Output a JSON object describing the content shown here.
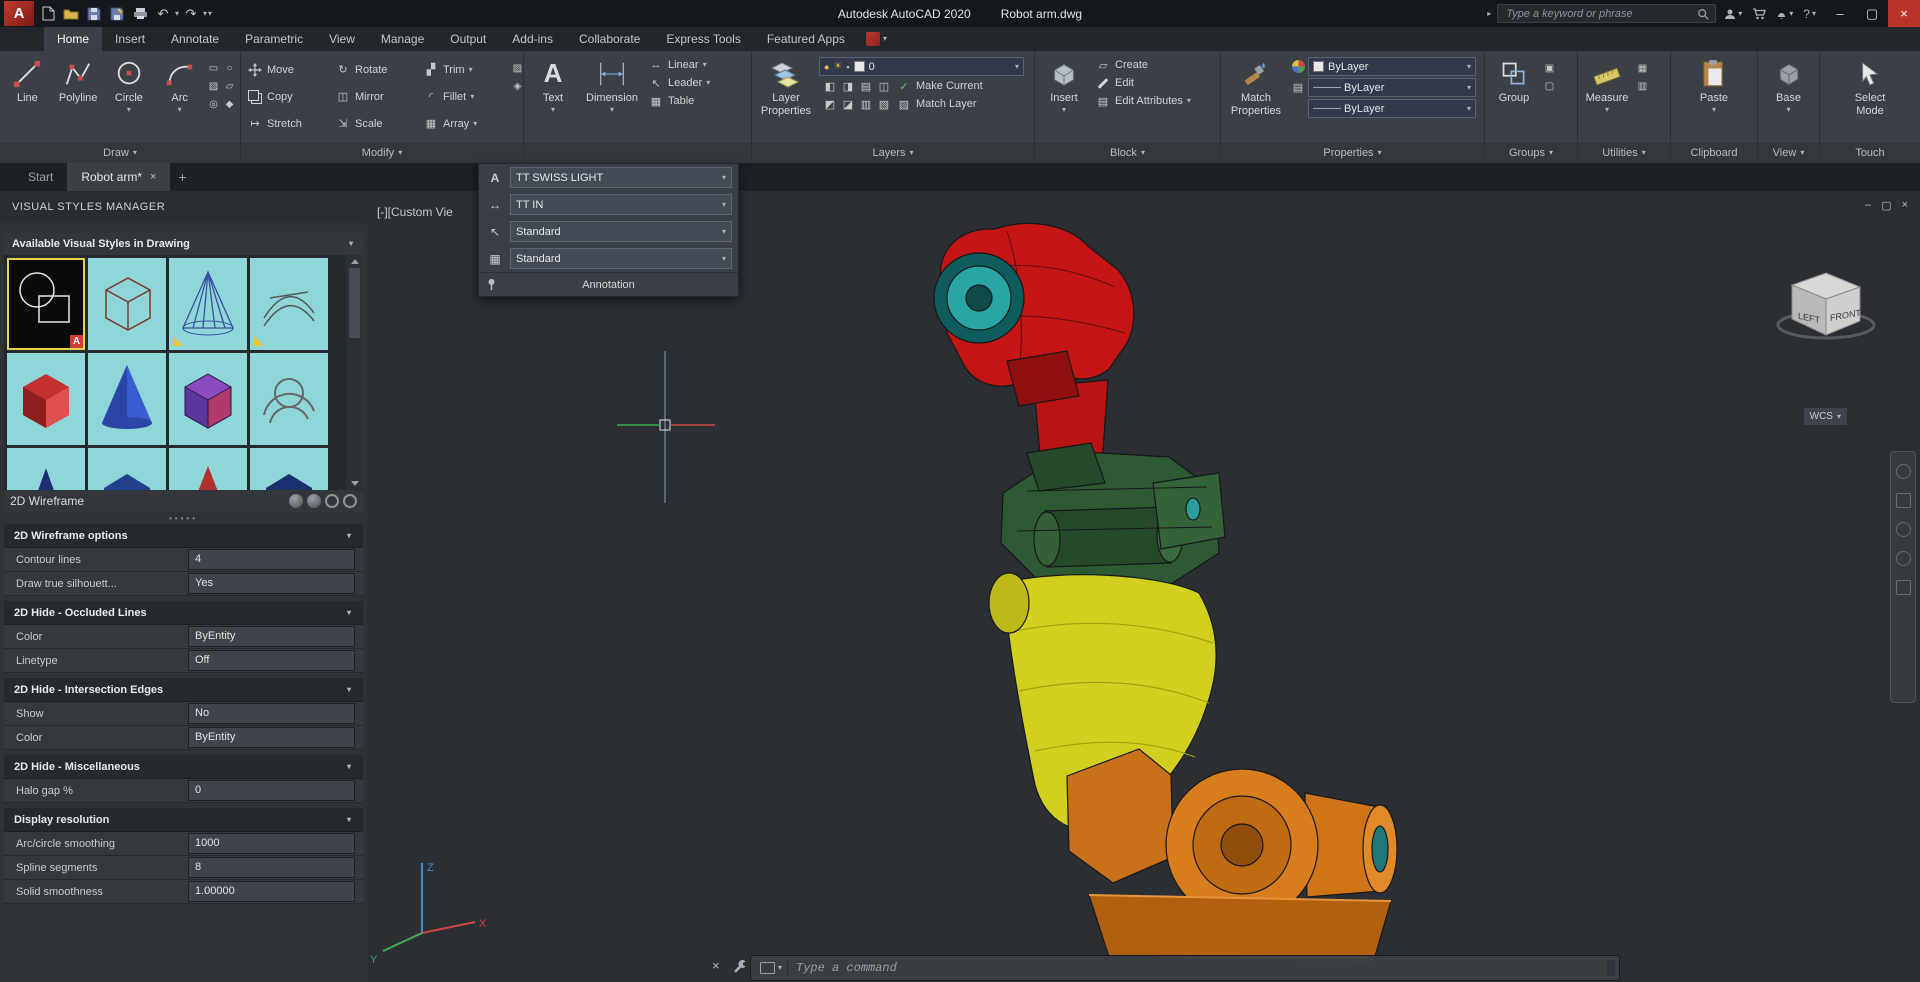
{
  "colors": {
    "viewport_bg": "#2b2f34",
    "ribbon_bg": "#3b4046",
    "accent_red": "#c41414",
    "joint_teal": "#2aa5a5",
    "arm_green": "#2e5a33",
    "arm_yellow": "#d3cf1e",
    "base_orange": "#d87d1d",
    "highlight_yellow": "#e8d44d"
  },
  "glyphs": {
    "caret": "▾",
    "chev_right": "▸",
    "min": "–",
    "max": "▢",
    "close": "×",
    "undo": "↶",
    "redo": "↷",
    "plus": "+",
    "dots": "•••••",
    "question": "?",
    "rotate": "↻",
    "mirror": "◫",
    "fillet": "◜",
    "stretch": "↦",
    "scale": "⇲",
    "array": "▦",
    "trim": "▞",
    "erase": "▨",
    "explode": "◈",
    "draw_minis": [
      "▭",
      "○",
      "▱",
      "▨",
      "◎",
      "◆"
    ],
    "bulb": "●",
    "sun": "☀",
    "lock": "▪",
    "swatch": "▫",
    "check": "✓",
    "match_layer": "▨",
    "create": "▱",
    "edit_attr": "▤",
    "text_style": "A",
    "dim_style": "↔",
    "leader": "↖",
    "table": "▦",
    "line_sample": "———",
    "layer_minis1": [
      "◧",
      "◨",
      "▤",
      "◫"
    ],
    "layer_minis2": [
      "◩",
      "◪",
      "▥",
      "▧"
    ],
    "group_minis": [
      "▣",
      "▢"
    ],
    "util_minis": [
      "▦",
      "▥"
    ]
  },
  "titlebar": {
    "app_title": "Autodesk AutoCAD 2020",
    "doc_title": "Robot arm.dwg",
    "search_placeholder": "Type a keyword or phrase"
  },
  "ribbon": {
    "tabs": [
      "Home",
      "Insert",
      "Annotate",
      "Parametric",
      "View",
      "Manage",
      "Output",
      "Add-ins",
      "Collaborate",
      "Express Tools",
      "Featured Apps"
    ],
    "draw": {
      "label": "Draw",
      "line": "Line",
      "polyline": "Polyline",
      "circle": "Circle",
      "arc": "Arc"
    },
    "modify": {
      "label": "Modify",
      "move": "Move",
      "rotate": "Rotate",
      "trim": "Trim",
      "copy": "Copy",
      "mirror": "Mirror",
      "fillet": "Fillet",
      "stretch": "Stretch",
      "scale": "Scale",
      "array": "Array"
    },
    "annotation": {
      "text": "Text",
      "dimension": "Dimension",
      "linear": "Linear",
      "leader": "Leader",
      "table": "Table"
    },
    "layers": {
      "label": "Layers",
      "big": "Layer Properties",
      "layer_value": "0",
      "make_current": "Make Current",
      "match_layer": "Match Layer"
    },
    "block": {
      "label": "Block",
      "big": "Insert",
      "create": "Create",
      "edit": "Edit",
      "edit_attributes": "Edit Attributes"
    },
    "properties": {
      "label": "Properties",
      "big": "Match Properties",
      "dd1": "ByLayer",
      "dd2": "ByLayer",
      "dd3": "ByLayer"
    },
    "groups": {
      "label": "Groups",
      "big": "Group"
    },
    "utilities": {
      "label": "Utilities",
      "big": "Measure"
    },
    "clipboard": {
      "label": "Clipboard",
      "big": "Paste"
    },
    "view": {
      "label": "View",
      "big": "Base"
    },
    "touch": {
      "label": "Touch",
      "big": "Select Mode"
    }
  },
  "flyout": {
    "text_style": "TT SWISS LIGHT",
    "dim_style": "TT IN",
    "mleader_style": "Standard",
    "table_style": "Standard",
    "title": "Annotation"
  },
  "file_tabs": {
    "start": "Start",
    "doc": "Robot arm*"
  },
  "palette": {
    "title": "VISUAL STYLES MANAGER",
    "styles_header": "Available Visual Styles in Drawing",
    "selected_style": "2D Wireframe",
    "groups": [
      {
        "header": "2D Wireframe options",
        "rows": [
          {
            "label": "Contour lines",
            "value": "4"
          },
          {
            "label": "Draw true silhouett...",
            "value": "Yes"
          }
        ]
      },
      {
        "header": "2D Hide - Occluded Lines",
        "rows": [
          {
            "label": "Color",
            "value": "ByEntity"
          },
          {
            "label": "Linetype",
            "value": "Off"
          }
        ]
      },
      {
        "header": "2D Hide - Intersection Edges",
        "rows": [
          {
            "label": "Show",
            "value": "No"
          },
          {
            "label": "Color",
            "value": "ByEntity"
          }
        ]
      },
      {
        "header": "2D Hide - Miscellaneous",
        "rows": [
          {
            "label": "Halo gap %",
            "value": "0"
          }
        ]
      },
      {
        "header": "Display resolution",
        "rows": [
          {
            "label": "Arc/circle smoothing",
            "value": "1000"
          },
          {
            "label": "Spline segments",
            "value": "8"
          },
          {
            "label": "Solid smoothness",
            "value": "1.00000"
          }
        ]
      }
    ]
  },
  "viewport": {
    "view_label": "[-][Custom Vie",
    "viewcube": {
      "left_face": "LEFT",
      "front_face": "FRONT",
      "wcs_label": "WCS"
    },
    "ucs": {
      "x": "X",
      "y": "Y",
      "z": "Z"
    }
  },
  "command_line": {
    "placeholder": "Type a command"
  }
}
